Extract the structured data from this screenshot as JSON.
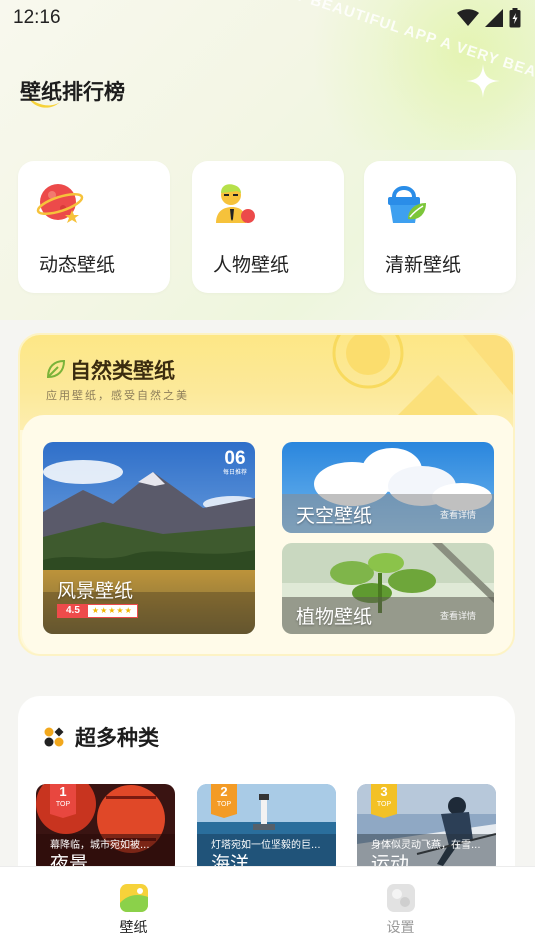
{
  "status_bar": {
    "time": "12:16"
  },
  "decoration": {
    "text": "VERY BEAUTIFUL APP  A VERY BEAU"
  },
  "page": {
    "title": "壁纸排行榜"
  },
  "quick_categories": [
    {
      "label": "动态壁纸",
      "icon": "planet-icon"
    },
    {
      "label": "人物壁纸",
      "icon": "person-icon"
    },
    {
      "label": "清新壁纸",
      "icon": "fresh-bag-icon"
    }
  ],
  "nature_section": {
    "title": "自然类壁纸",
    "subtitle": "应用壁纸，感受自然之美",
    "feature": {
      "label": "风景壁纸",
      "number": "06",
      "number_caption": "每日推荐",
      "rating": "4.5",
      "stars": "★★★★★"
    },
    "items": [
      {
        "label": "天空壁纸",
        "link": "查看详情"
      },
      {
        "label": "植物壁纸",
        "link": "查看详情"
      }
    ]
  },
  "category_section": {
    "title": "超多种类",
    "tiles": [
      {
        "rank": "1",
        "top": "TOP",
        "desc": "幕降临，城市宛如被...",
        "name": "夜景",
        "badge_color": "#e8473f"
      },
      {
        "rank": "2",
        "top": "TOP",
        "desc": "灯塔宛如一位坚毅的巨...",
        "name": "海洋",
        "badge_color": "#f39b26"
      },
      {
        "rank": "3",
        "top": "TOP",
        "desc": "身体似灵动飞燕，在雪...",
        "name": "运动",
        "badge_color": "#f3c126"
      }
    ]
  },
  "tabbar": {
    "tabs": [
      {
        "label": "壁纸",
        "active": true
      },
      {
        "label": "设置",
        "active": false
      }
    ]
  },
  "colors": {
    "accent_yellow": "#fde786",
    "rating_red": "#ee4b4b",
    "active_tab_text": "#222222",
    "inactive_tab_text": "#9a9a9a"
  }
}
